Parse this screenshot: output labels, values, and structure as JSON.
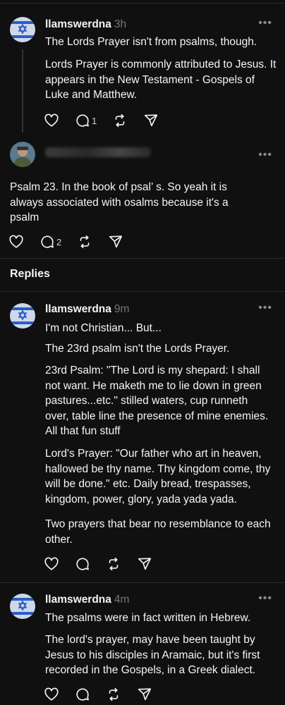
{
  "post1": {
    "username": "llamswerdna",
    "time": "3h",
    "paragraphs": [
      "The Lords Prayer isn't from psalms, though.",
      "Lords Prayer is commonly attributed to Jesus. It appears in the New Testament - Gospels of Luke and Matthew."
    ],
    "reply_count": "1"
  },
  "post2": {
    "paragraphs": [
      "Psalm 23. In the book of psal’ s. So yeah it is always associated with osalms because it's a psalm"
    ],
    "reply_count": "2"
  },
  "replies_header": "Replies",
  "reply1": {
    "username": "llamswerdna",
    "time": "9m",
    "paragraphs": [
      "I'm not Christian... But...",
      "The 23rd psalm isn't the Lords Prayer.",
      "23rd Psalm: \"The Lord is my shepard: I shall not want. He maketh me to lie down in green pastures...etc.\" stilled waters, cup runneth over, table line the presence of mine enemies. All that fun stuff",
      "Lord's Prayer: \"Our father who art in heaven, hallowed be thy name. Thy kingdom come, thy will be done.\" etc.  Daily bread, trespasses, kingdom, power, glory, yada yada yada.",
      "Two prayers that bear no resemblance to each other."
    ]
  },
  "reply2": {
    "username": "llamswerdna",
    "time": "4m",
    "paragraphs": [
      "The psalms were in fact written in Hebrew.",
      "The lord's prayer, may have been taught by Jesus to his disciples in Aramaic, but it's first recorded in the Gospels, in a Greek dialect."
    ]
  },
  "more_label": "•••",
  "colors": {
    "background": "#101010",
    "text": "#f3f5f7",
    "muted": "#777777",
    "divider": "#2a2a2a",
    "flag_blue": "#2b5cc4"
  }
}
